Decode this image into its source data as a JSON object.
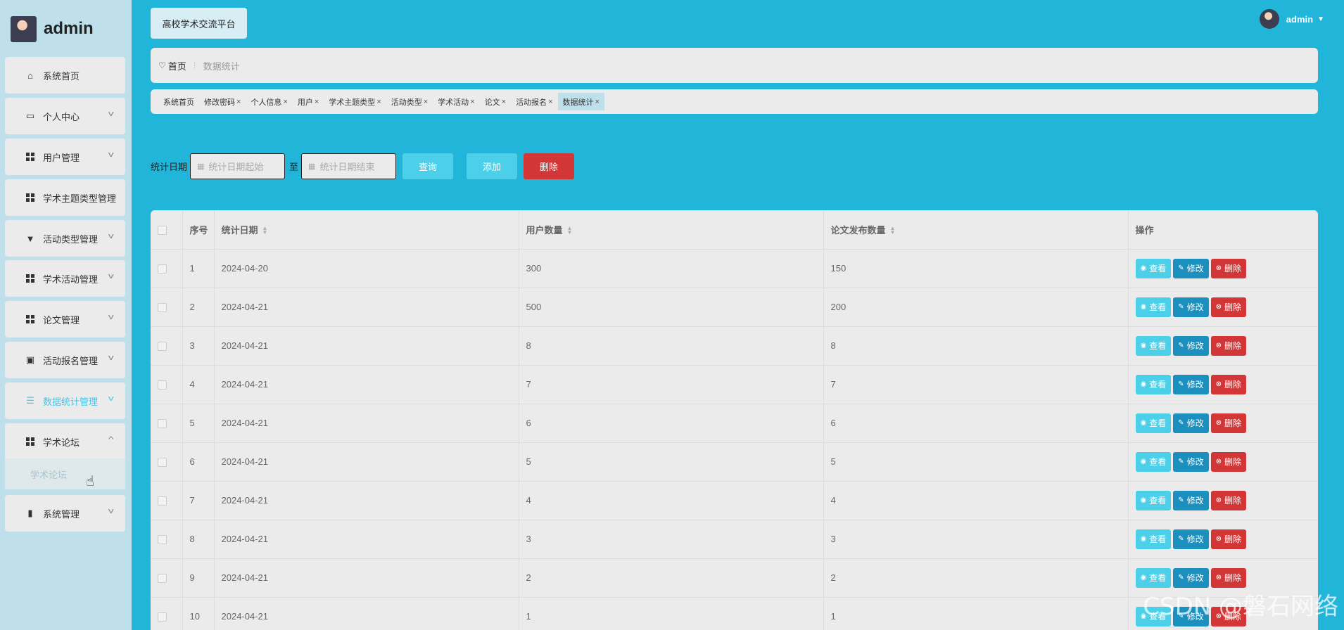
{
  "sidebar": {
    "title": "admin",
    "items": [
      {
        "label": "系统首页",
        "icon": "home-icon",
        "chevron": false
      },
      {
        "label": "个人中心",
        "icon": "card-icon",
        "chevron": true
      },
      {
        "label": "用户管理",
        "icon": "grid-icon",
        "chevron": true
      },
      {
        "label": "学术主题类型管理",
        "icon": "grid-icon",
        "chevron": false
      },
      {
        "label": "活动类型管理",
        "icon": "brush-icon",
        "chevron": true
      },
      {
        "label": "学术活动管理",
        "icon": "grid-icon",
        "chevron": true
      },
      {
        "label": "论文管理",
        "icon": "grid-icon",
        "chevron": true
      },
      {
        "label": "活动报名管理",
        "icon": "clipboard-icon",
        "chevron": true
      },
      {
        "label": "数据统计管理",
        "icon": "list-icon",
        "chevron": true,
        "active": true
      },
      {
        "label": "学术论坛",
        "icon": "grid-icon",
        "chevron": true,
        "expanded": true
      },
      {
        "label": "系统管理",
        "icon": "bar-chart-icon",
        "chevron": true
      }
    ],
    "sub_item": "学术论坛"
  },
  "header": {
    "platform_label": "高校学术交流平台",
    "username": "admin"
  },
  "breadcrumb": {
    "home": "首页",
    "current": "数据统计"
  },
  "tags": [
    {
      "label": "系统首页",
      "closable": false
    },
    {
      "label": "修改密码",
      "closable": true
    },
    {
      "label": "个人信息",
      "closable": true
    },
    {
      "label": "用户",
      "closable": true
    },
    {
      "label": "学术主题类型",
      "closable": true
    },
    {
      "label": "活动类型",
      "closable": true
    },
    {
      "label": "学术活动",
      "closable": true
    },
    {
      "label": "论文",
      "closable": true
    },
    {
      "label": "活动报名",
      "closable": true
    },
    {
      "label": "数据统计",
      "closable": true,
      "active": true
    }
  ],
  "search": {
    "label": "统计日期",
    "start_placeholder": "统计日期起始",
    "to": "至",
    "end_placeholder": "统计日期结束",
    "query_label": "查询",
    "add_label": "添加",
    "delete_label": "删除"
  },
  "table": {
    "columns": [
      "序号",
      "统计日期",
      "用户数量",
      "论文发布数量",
      "操作"
    ],
    "rows": [
      {
        "no": "1",
        "date": "2024-04-20",
        "users": "300",
        "papers": "150"
      },
      {
        "no": "2",
        "date": "2024-04-21",
        "users": "500",
        "papers": "200"
      },
      {
        "no": "3",
        "date": "2024-04-21",
        "users": "8",
        "papers": "8"
      },
      {
        "no": "4",
        "date": "2024-04-21",
        "users": "7",
        "papers": "7"
      },
      {
        "no": "5",
        "date": "2024-04-21",
        "users": "6",
        "papers": "6"
      },
      {
        "no": "6",
        "date": "2024-04-21",
        "users": "5",
        "papers": "5"
      },
      {
        "no": "7",
        "date": "2024-04-21",
        "users": "4",
        "papers": "4"
      },
      {
        "no": "8",
        "date": "2024-04-21",
        "users": "3",
        "papers": "3"
      },
      {
        "no": "9",
        "date": "2024-04-21",
        "users": "2",
        "papers": "2"
      },
      {
        "no": "10",
        "date": "2024-04-21",
        "users": "1",
        "papers": "1"
      }
    ],
    "ops": {
      "view": "查看",
      "edit": "修改",
      "delete": "删除"
    }
  },
  "watermark": "CSDN @磐石网络",
  "colors": {
    "background": "#21b5da",
    "sidebar": "#bfe0ea",
    "accent": "#4cd0ea",
    "edit": "#1b8fbe",
    "danger": "#d33636"
  }
}
